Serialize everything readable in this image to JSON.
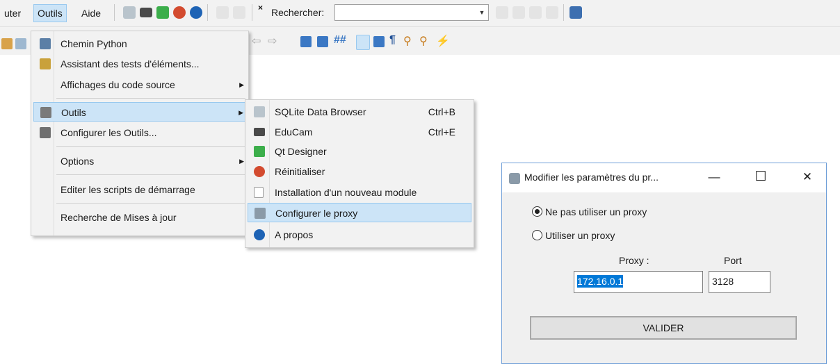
{
  "menubar": {
    "partial_item": "uter",
    "active_item": "Outils",
    "help_item": "Aide",
    "search_label": "Rechercher:",
    "search_value": ""
  },
  "main_menu": {
    "items": [
      {
        "label": "Chemin Python",
        "icon": "python-path-icon",
        "submenu": false
      },
      {
        "label": "Assistant des tests d'éléments...",
        "icon": "wizard-icon",
        "submenu": false
      },
      {
        "label": "Affichages du code source",
        "icon": "",
        "submenu": true
      },
      {
        "label": "Outils",
        "icon": "hammer-icon",
        "submenu": true,
        "highlighted": true
      },
      {
        "label": "Configurer les Outils...",
        "icon": "configure-tools-icon",
        "submenu": false
      },
      {
        "label": "Options",
        "icon": "",
        "submenu": true
      },
      {
        "label": "Editer les scripts de démarrage",
        "icon": "",
        "submenu": false
      },
      {
        "label": "Recherche de Mises à jour",
        "icon": "",
        "submenu": false
      }
    ]
  },
  "tools_submenu": {
    "items": [
      {
        "label": "SQLite Data Browser",
        "shortcut": "Ctrl+B",
        "icon": "database-icon"
      },
      {
        "label": "EduCam",
        "shortcut": "Ctrl+E",
        "icon": "camera-icon"
      },
      {
        "label": "Qt Designer",
        "shortcut": "",
        "icon": "qt-icon"
      },
      {
        "label": "Réinitialiser",
        "shortcut": "",
        "icon": "reset-icon"
      },
      {
        "label": "Installation d'un nouveau module",
        "shortcut": "",
        "icon": "module-icon"
      },
      {
        "label": "Configurer le proxy",
        "shortcut": "",
        "icon": "proxy-icon",
        "highlighted": true
      },
      {
        "label": "A propos",
        "shortcut": "",
        "icon": "help-icon"
      }
    ]
  },
  "dialog": {
    "title": "Modifier les paramètres du pr...",
    "minimize": "—",
    "maximize": "☐",
    "close": "✕",
    "radio_no_proxy": "Ne pas utiliser un proxy",
    "radio_use_proxy": "Utiliser un proxy",
    "selected_option": "no_proxy",
    "proxy_label": "Proxy :",
    "port_label": "Port",
    "proxy_value": "172.16.0.1",
    "port_value": "3128",
    "submit_label": "VALIDER"
  },
  "colors": {
    "menu_bg": "#f2f2f2",
    "highlight_bg": "#cce4f7",
    "highlight_border": "#99c9ef",
    "selection": "#0078d7",
    "dialog_border": "#6f9fd8"
  }
}
